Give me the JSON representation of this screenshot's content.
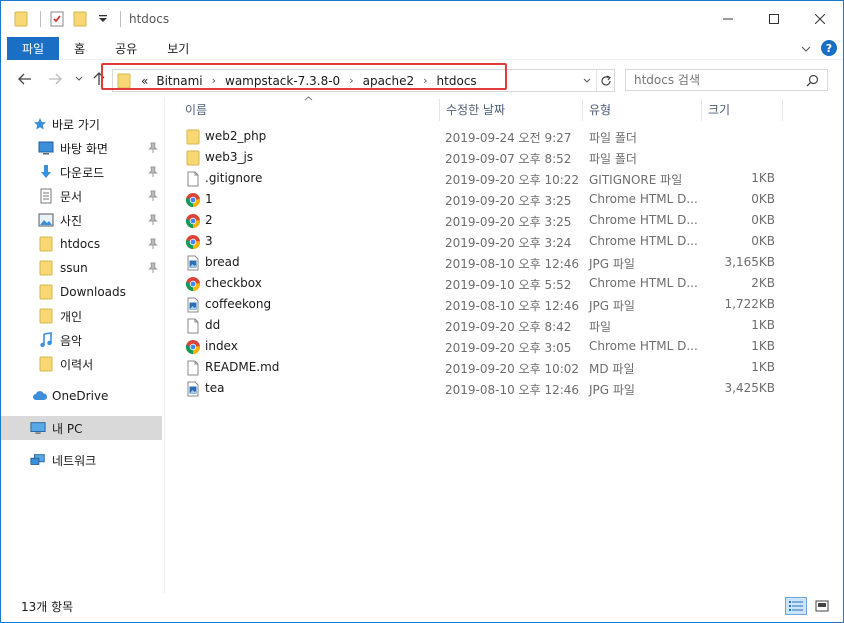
{
  "window": {
    "title": "htdocs"
  },
  "ribbon": {
    "tabs": [
      "파일",
      "홈",
      "공유",
      "보기"
    ]
  },
  "address": {
    "overflow": "«",
    "crumbs": [
      "Bitnami",
      "wampstack-7.3.8-0",
      "apache2",
      "htdocs"
    ]
  },
  "search": {
    "placeholder": "htdocs 검색"
  },
  "sidebar": {
    "items": [
      {
        "label": "바로 가기",
        "icon": "star-icon"
      },
      {
        "label": "바탕 화면",
        "icon": "desktop-icon",
        "pinned": true
      },
      {
        "label": "다운로드",
        "icon": "download-icon",
        "pinned": true
      },
      {
        "label": "문서",
        "icon": "document-icon",
        "pinned": true
      },
      {
        "label": "사진",
        "icon": "pictures-icon",
        "pinned": true
      },
      {
        "label": "htdocs",
        "icon": "folder-icon",
        "pinned": true
      },
      {
        "label": "ssun",
        "icon": "folder-icon",
        "pinned": true
      },
      {
        "label": "Downloads",
        "icon": "folder-icon"
      },
      {
        "label": "개인",
        "icon": "folder-icon"
      },
      {
        "label": "음악",
        "icon": "music-icon"
      },
      {
        "label": "이력서",
        "icon": "folder-icon"
      },
      {
        "label": "OneDrive",
        "icon": "cloud-icon"
      },
      {
        "label": "내 PC",
        "icon": "pc-icon",
        "selected": true
      },
      {
        "label": "네트워크",
        "icon": "network-icon"
      }
    ]
  },
  "columns": {
    "name": "이름",
    "date": "수정한 날짜",
    "type": "유형",
    "size": "크기"
  },
  "files": [
    {
      "name": "web2_php",
      "date": "2019-09-24 오전 9:27",
      "type": "파일 폴더",
      "size": "",
      "icon": "folder-icon"
    },
    {
      "name": "web3_js",
      "date": "2019-09-07 오후 8:52",
      "type": "파일 폴더",
      "size": "",
      "icon": "folder-icon"
    },
    {
      "name": ".gitignore",
      "date": "2019-09-20 오후 10:22",
      "type": "GITIGNORE 파일",
      "size": "1KB",
      "icon": "file-icon"
    },
    {
      "name": "1",
      "date": "2019-09-20 오후 3:25",
      "type": "Chrome HTML D...",
      "size": "0KB",
      "icon": "chrome-icon"
    },
    {
      "name": "2",
      "date": "2019-09-20 오후 3:25",
      "type": "Chrome HTML D...",
      "size": "0KB",
      "icon": "chrome-icon"
    },
    {
      "name": "3",
      "date": "2019-09-20 오후 3:24",
      "type": "Chrome HTML D...",
      "size": "0KB",
      "icon": "chrome-icon"
    },
    {
      "name": "bread",
      "date": "2019-08-10 오후 12:46",
      "type": "JPG 파일",
      "size": "3,165KB",
      "icon": "image-icon"
    },
    {
      "name": "checkbox",
      "date": "2019-09-10 오후 5:52",
      "type": "Chrome HTML D...",
      "size": "2KB",
      "icon": "chrome-icon"
    },
    {
      "name": "coffeekong",
      "date": "2019-08-10 오후 12:46",
      "type": "JPG 파일",
      "size": "1,722KB",
      "icon": "image-icon"
    },
    {
      "name": "dd",
      "date": "2019-09-20 오후 8:42",
      "type": "파일",
      "size": "1KB",
      "icon": "file-icon"
    },
    {
      "name": "index",
      "date": "2019-09-20 오후 3:05",
      "type": "Chrome HTML D...",
      "size": "1KB",
      "icon": "chrome-icon"
    },
    {
      "name": "README.md",
      "date": "2019-09-20 오후 10:02",
      "type": "MD 파일",
      "size": "1KB",
      "icon": "file-icon"
    },
    {
      "name": "tea",
      "date": "2019-08-10 오후 12:46",
      "type": "JPG 파일",
      "size": "3,425KB",
      "icon": "image-icon"
    }
  ],
  "status": {
    "count": "13개 항목"
  },
  "colors": {
    "accent": "#1a6fc4",
    "highlight": "#e23b3b",
    "folder": "#f8d775",
    "selected": "#d9d9d9"
  }
}
